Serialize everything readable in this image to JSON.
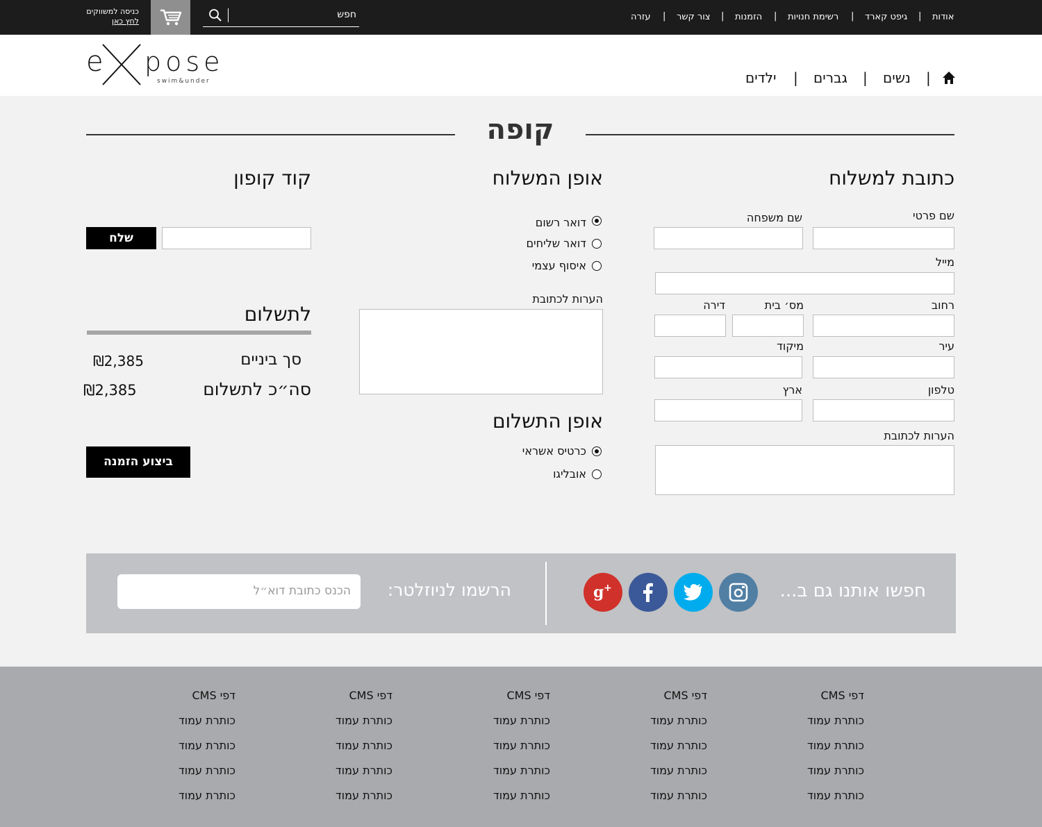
{
  "topbar": {
    "links": [
      "אודות",
      "גיפט קארד",
      "רשימת חנויות",
      "הזמנות",
      "צור קשר",
      "עזרה"
    ],
    "search_placeholder": "חפש",
    "login_line1": "כניסה למשווקים",
    "login_line2": "לחץ כאן",
    "icons": [
      "search-icon",
      "cart-icon"
    ]
  },
  "header": {
    "logo_text": "expose",
    "logo_sub": "swim&under",
    "nav": [
      "נשים",
      "גברים",
      "ילדים"
    ],
    "home_icon": "home-icon"
  },
  "page_title": "קופה",
  "shipping_address": {
    "title": "כתובת למשלוח",
    "first_name_label": "שם פרטי",
    "last_name_label": "שם משפחה",
    "email_label": "מייל",
    "street_label": "רחוב",
    "house_no_label": "מס׳ בית",
    "apartment_label": "דירה",
    "city_label": "עיר",
    "zip_label": "מיקוד",
    "phone_label": "טלפון",
    "country_label": "ארץ",
    "notes_label": "הערות לכתובת"
  },
  "shipping_method": {
    "title": "אופן המשלוח",
    "options": [
      {
        "label": "דואר רשום",
        "selected": true
      },
      {
        "label": "דואר שליחים",
        "selected": false
      },
      {
        "label": "איסוף עצמי",
        "selected": false
      }
    ],
    "notes_label": "הערות לכתובת"
  },
  "payment_method": {
    "title": "אופן התשלום",
    "options": [
      {
        "label": "כרטיס אשראי",
        "selected": true
      },
      {
        "label": "אובליגו",
        "selected": false
      }
    ]
  },
  "coupon": {
    "title": "קוד קופון",
    "send_label": "שלח"
  },
  "summary": {
    "title": "לתשלום",
    "subtotal_label": "סך ביניים",
    "subtotal_value": "₪2,385",
    "total_label": "סה״כ לתשלום",
    "total_value": "₪2,385",
    "order_button": "ביצוע הזמנה"
  },
  "newsletter": {
    "follow_text": "חפשו אותנו גם ב...",
    "signup_label": "הרשמו לניוזלטר:",
    "email_placeholder": "הכנס כתובת דוא״ל",
    "social": [
      {
        "name": "instagram-icon",
        "color": "#517fa4"
      },
      {
        "name": "twitter-icon",
        "color": "#00aced"
      },
      {
        "name": "facebook-icon",
        "color": "#3b5998"
      },
      {
        "name": "google-plus-icon",
        "color": "#d0312a"
      }
    ]
  },
  "footer": {
    "columns": [
      {
        "heading": "דפי CMS",
        "items": [
          "כותרת עמוד",
          "כותרת עמוד",
          "כותרת עמוד",
          "כותרת עמוד"
        ]
      },
      {
        "heading": "דפי CMS",
        "items": [
          "כותרת עמוד",
          "כותרת עמוד",
          "כותרת עמוד",
          "כותרת עמוד"
        ]
      },
      {
        "heading": "דפי CMS",
        "items": [
          "כותרת עמוד",
          "כותרת עמוד",
          "כותרת עמוד",
          "כותרת עמוד"
        ]
      },
      {
        "heading": "דפי CMS",
        "items": [
          "כותרת עמוד",
          "כותרת עמוד",
          "כותרת עמוד",
          "כותרת עמוד"
        ]
      },
      {
        "heading": "דפי CMS",
        "items": [
          "כותרת עמוד",
          "כותרת עמוד",
          "כותרת עמוד",
          "כותרת עמוד"
        ]
      }
    ]
  }
}
